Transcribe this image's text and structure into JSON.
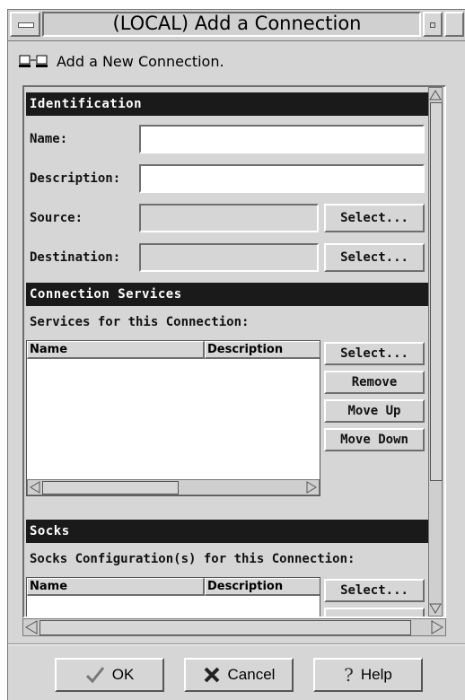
{
  "window": {
    "title": "(LOCAL) Add a Connection"
  },
  "header": {
    "text": "Add a New Connection.",
    "icon": "network-computers-icon"
  },
  "identification": {
    "title": "Identification",
    "name_label": "Name:",
    "name_value": "",
    "description_label": "Description:",
    "description_value": "",
    "source_label": "Source:",
    "source_value": "",
    "source_select": "Select...",
    "destination_label": "Destination:",
    "destination_value": "",
    "destination_select": "Select..."
  },
  "connection_services": {
    "title": "Connection Services",
    "subtitle": "Services for this Connection:",
    "columns": [
      "Name",
      "Description"
    ],
    "rows": [],
    "buttons": {
      "select": "Select...",
      "remove": "Remove",
      "move_up": "Move Up",
      "move_down": "Move Down"
    }
  },
  "socks": {
    "title": "Socks",
    "subtitle": "Socks Configuration(s) for this Connection:",
    "columns": [
      "Name",
      "Description"
    ],
    "rows": [],
    "buttons": {
      "select": "Select..."
    }
  },
  "footer": {
    "ok": "OK",
    "cancel": "Cancel",
    "help": "Help"
  }
}
